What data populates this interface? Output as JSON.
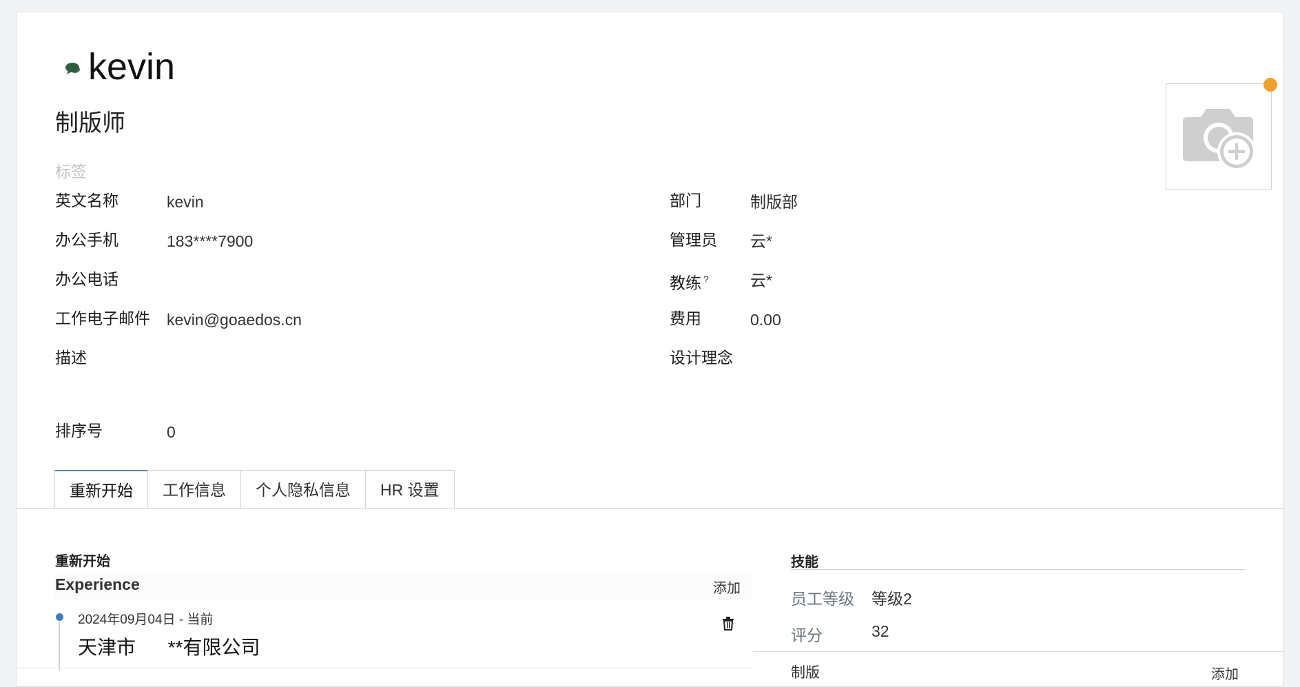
{
  "employee": {
    "name": "kevin",
    "job_title": "制版师",
    "tags_placeholder": "标签"
  },
  "fields_left": [
    {
      "label": "英文名称",
      "value": "kevin"
    },
    {
      "label": "办公手机",
      "value": "183****7900"
    },
    {
      "label": "办公电话",
      "value": ""
    },
    {
      "label": "工作电子邮件",
      "value": "kevin@goaedos.cn"
    },
    {
      "label": "描述",
      "value": ""
    },
    {
      "label": "排序号",
      "value": "0"
    }
  ],
  "fields_right": [
    {
      "label": "部门",
      "value": "制版部"
    },
    {
      "label": "管理员",
      "value": "云*"
    },
    {
      "label": "教练",
      "value": "云*",
      "help": "?"
    },
    {
      "label": "费用",
      "value": "0.00"
    },
    {
      "label": "设计理念",
      "value": ""
    }
  ],
  "tabs": [
    "重新开始",
    "工作信息",
    "个人隐私信息",
    "HR 设置"
  ],
  "resume": {
    "section_title": "重新开始",
    "experience_heading": "Experience",
    "add_label": "添加",
    "entry": {
      "date": "2024年09月04日 - 当前",
      "company": "天津市      **有限公司"
    }
  },
  "skills": {
    "section_title": "技能",
    "rows": [
      {
        "label": "员工等级",
        "value": "等级2"
      },
      {
        "label": "评分",
        "value": "32"
      }
    ],
    "next_section": "制版",
    "add_label": "添加"
  },
  "colors": {
    "status_dot": "#2e5e3e",
    "avatar_badge": "#f0a02b",
    "timeline_dot": "#3f7fbf",
    "tab_active_border": "#5b8ab0"
  }
}
